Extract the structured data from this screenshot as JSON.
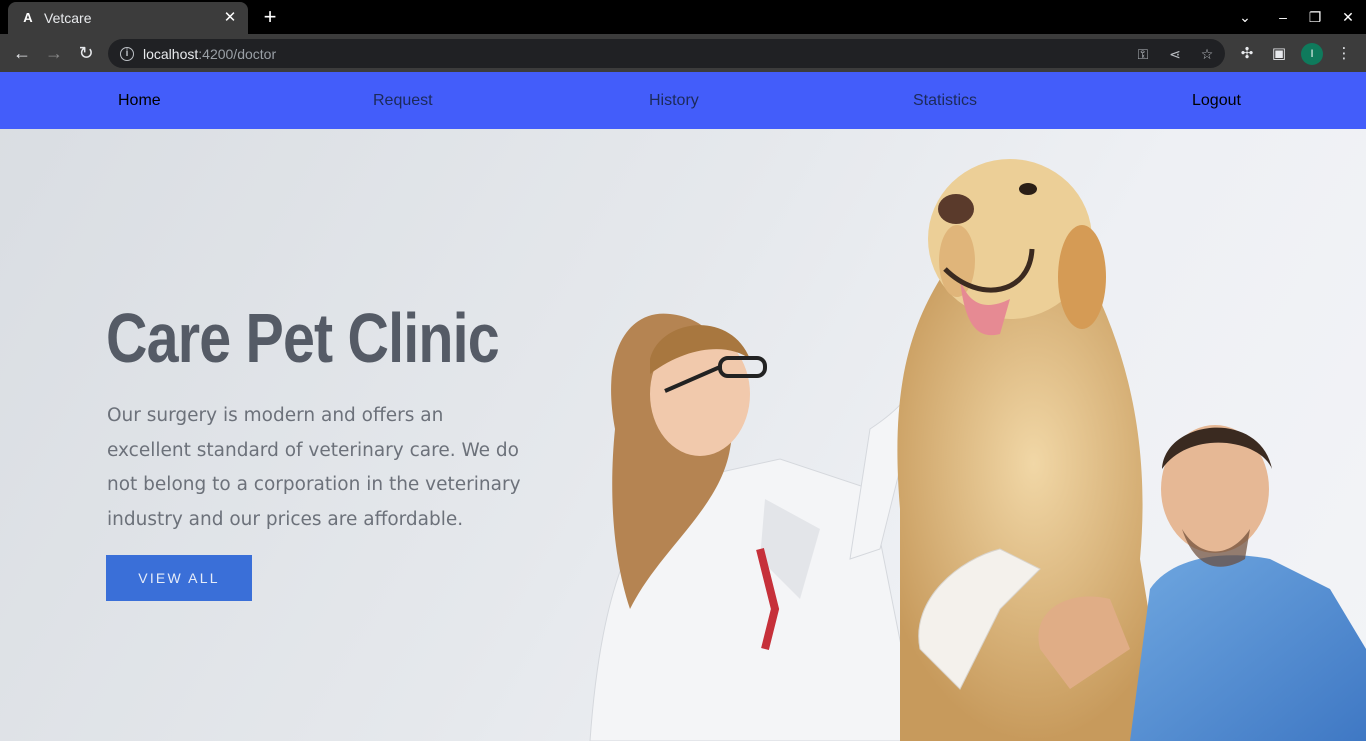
{
  "browser": {
    "tab_title": "Vetcare",
    "tab_favicon": "A",
    "url_host": "localhost",
    "url_path": ":4200/doctor",
    "profile_initial": "I",
    "icons": {
      "back": "back-arrow-icon",
      "forward": "forward-arrow-icon",
      "reload": "reload-icon",
      "info": "info-icon",
      "key": "key-icon",
      "share": "share-icon",
      "star": "star-icon",
      "extensions": "puzzle-icon",
      "sidepanel": "side-panel-icon",
      "menu": "kebab-menu-icon"
    }
  },
  "navbar": {
    "background": "#435dfa",
    "items": [
      {
        "label": "Home"
      },
      {
        "label": "Request"
      },
      {
        "label": "History"
      },
      {
        "label": "Statistics"
      },
      {
        "label": "Logout"
      }
    ]
  },
  "hero": {
    "title": "Care Pet Clinic",
    "description": "Our surgery is modern and offers an excellent standard of veterinary care. We do not belong to a corporation in the veterinary industry and our prices are affordable.",
    "button_label": "VIEW ALL",
    "button_color": "#3a6fd8"
  }
}
